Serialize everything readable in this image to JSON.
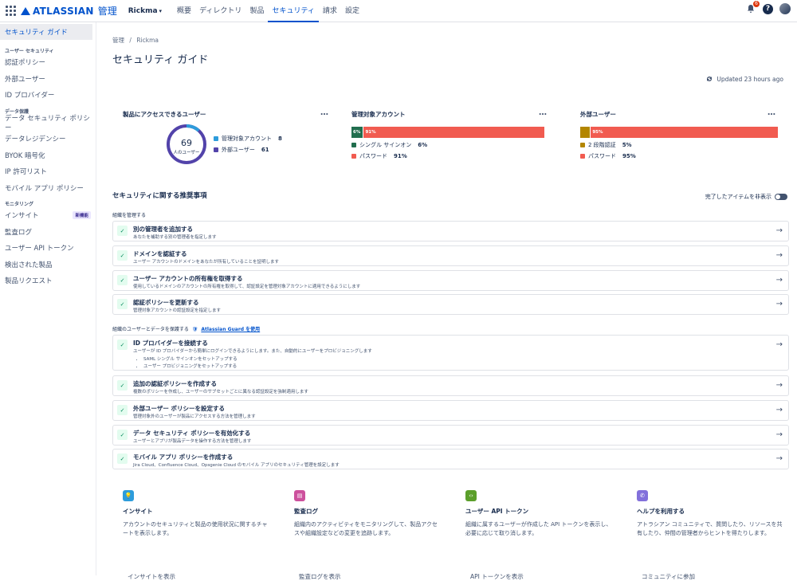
{
  "topbar": {
    "brand": "ATLASSIAN",
    "app": "管理",
    "org": "Rickma",
    "nav": [
      "概要",
      "ディレクトリ",
      "製品",
      "セキュリティ",
      "請求",
      "設定"
    ],
    "active_nav": "セキュリティ",
    "notification_count": "6"
  },
  "sidebar": {
    "top_item": "セキュリティ ガイド",
    "sections": [
      {
        "heading": "ユーザー セキュリティ",
        "items": [
          "認証ポリシー",
          "外部ユーザー",
          "ID プロバイダー"
        ]
      },
      {
        "heading": "データ保護",
        "items": [
          "データ セキュリティ ポリシー",
          "データレジデンシー",
          "BYOK 暗号化",
          "IP 許可リスト",
          "モバイル アプリ ポリシー"
        ]
      },
      {
        "heading": "モニタリング",
        "items": [
          "インサイト",
          "監査ログ",
          "ユーザー API トークン",
          "検出された製品",
          "製品リクエスト"
        ]
      }
    ],
    "new_badge": "新機能"
  },
  "page": {
    "breadcrumb": [
      "管理",
      "Rickma"
    ],
    "title": "セキュリティ ガイド",
    "updated": "Updated 23 hours ago"
  },
  "cards": {
    "access": {
      "title": "製品にアクセスできるユーザー",
      "total": "69",
      "total_label": "人のユーザー",
      "legend": [
        {
          "label": "管理対象アカウント",
          "value": 8,
          "color": "#2d9cdb"
        },
        {
          "label": "外部ユーザー",
          "value": 61,
          "color": "#5243aa"
        }
      ]
    },
    "managed": {
      "title": "管理対象アカウント",
      "segments": [
        {
          "label": "6%",
          "pct": 6,
          "color": "#216e4e"
        },
        {
          "label": "91%",
          "pct": 91,
          "color": "#f15b50"
        }
      ],
      "legend": [
        {
          "label": "シングル サインオン",
          "value": "6%",
          "color": "#216e4e"
        },
        {
          "label": "パスワード",
          "value": "91%",
          "color": "#f15b50"
        }
      ]
    },
    "external": {
      "title": "外部ユーザー",
      "segments": [
        {
          "label": "",
          "pct": 5,
          "color": "#b38600"
        },
        {
          "label": "95%",
          "pct": 95,
          "color": "#f15b50"
        }
      ],
      "legend": [
        {
          "label": "2 段階認証",
          "value": "5%",
          "color": "#b38600"
        },
        {
          "label": "パスワード",
          "value": "95%",
          "color": "#f15b50"
        }
      ]
    }
  },
  "recommendations": {
    "title": "セキュリティに関する推奨事項",
    "hide_completed": "完了したアイテムを非表示",
    "group1_label": "組織を管理する",
    "group1": [
      {
        "title": "別の管理者を追加する",
        "desc": "あなたを補助する別の管理者を指定します"
      },
      {
        "title": "ドメインを認証する",
        "desc": "ユーザー アカウントのドメインをあなたが所有していることを証明します"
      },
      {
        "title": "ユーザー アカウントの所有権を取得する",
        "desc": "使用しているドメインのアカウントの所有権を取得して、認証設定を管理対象アカウントに適用できるようにします"
      },
      {
        "title": "認証ポリシーを更新する",
        "desc": "管理対象アカウントの認証設定を指定します"
      }
    ],
    "group2_label": "組織のユーザーとデータを保護する",
    "group2_link": "Atlassian Guard を使用",
    "group2": [
      {
        "title": "ID プロバイダーを接続する",
        "desc": "ユーザーが ID プロバイダーから簡単にログインできるようにします。また、自動的にユーザーをプロビジョニングします",
        "bullets": [
          "SAML シングル サインオンをセットアップする",
          "ユーザー プロビジョニングをセットアップする"
        ]
      },
      {
        "title": "追加の認証ポリシーを作成する",
        "desc": "複数のポリシーを作成し、ユーザーのサブセットごとに異なる認証設定を強制適用します"
      },
      {
        "title": "外部ユーザー ポリシーを設定する",
        "desc": "管理対象外のユーザーが製品にアクセスする方法を管理します"
      },
      {
        "title": "データ セキュリティ ポリシーを有効化する",
        "desc": "ユーザーとアプリが製品データを操作する方法を管理します"
      },
      {
        "title": "モバイル アプリ ポリシーを作成する",
        "desc": "Jira Cloud、Confluence Cloud、Opsgenie Cloud のモバイル アプリのセキュリティ管理を設定します"
      }
    ]
  },
  "tiles": [
    {
      "title": "インサイト",
      "desc": "アカウントのセキュリティと製品の使用状況に関するチャートを表示します。",
      "link": "インサイトを表示",
      "color": "#2d9cdb",
      "icon": "lightbulb-icon"
    },
    {
      "title": "監査ログ",
      "desc": "組織内のアクティビティをモニタリングして、製品アクセスや組織設定などの変更を追跡します。",
      "link": "監査ログを表示",
      "color": "#cd519d",
      "icon": "log-icon"
    },
    {
      "title": "ユーザー API トークン",
      "desc": "組織に属するユーザーが作成した API トークンを表示し、必要に応じて取り消します。",
      "link": "API トークンを表示",
      "color": "#5b9f2b",
      "icon": "code-icon"
    },
    {
      "title": "ヘルプを利用する",
      "desc": "アトラシアン コミュニティで、質問したり、リソースを共有したり、仲間の管理者からヒントを得たりします。",
      "link": "コミュニティに参加",
      "color": "#8270db",
      "icon": "chat-icon"
    }
  ]
}
